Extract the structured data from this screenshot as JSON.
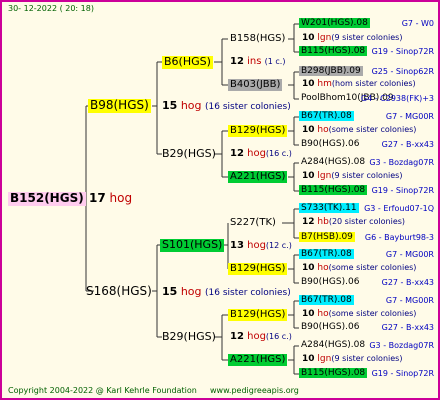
{
  "date": "30- 12-2022 ( 20: 18)",
  "copyright": "Copyright 2004-2022 @ Karl Kehrle Foundation",
  "url": "www.pedigreeapis.org",
  "colors": {
    "frame": "#cc0099",
    "hog": "#c00000",
    "link": "#0000c0"
  },
  "gen1": {
    "id": "B152(HGS)",
    "num": "17",
    "hog": "hog"
  },
  "gen2": [
    {
      "id": "B98(HGS)",
      "num": "15",
      "hog": "hog",
      "note": "(16 sister colonies)"
    },
    {
      "id": "S168(HGS)",
      "num": "15",
      "hog": "hog",
      "note": "(16 sister colonies)"
    }
  ],
  "gen3": [
    {
      "id": "B6(HGS)",
      "num": "12",
      "hog": "ins",
      "note": "(1 c.)"
    },
    {
      "id": "B29(HGS)",
      "num": "12",
      "hog": "hog",
      "note": "(16 c.)"
    },
    {
      "id": "S101(HGS)",
      "num": "13",
      "hog": "hog",
      "note": "(12 c.)"
    },
    {
      "id": "B29(HGS)",
      "num": "12",
      "hog": "hog",
      "note": "(16 c.)"
    }
  ],
  "gen4": [
    {
      "id": "B158(HGS)",
      "num": "10",
      "hog": "lgn",
      "note": "(9 sister colonies)"
    },
    {
      "id": "B403(JBB)",
      "num": "10",
      "hog": "hm",
      "note": "(hom sister colonies)"
    },
    {
      "id": "B129(HGS)",
      "num": "10",
      "hog": "ho",
      "note": "(some sister colonies)"
    },
    {
      "id": "A221(HGS)",
      "num": "10",
      "hog": "lgn",
      "note": "(9 sister colonies)"
    },
    {
      "id": "S227(TK)",
      "num": "12",
      "hog": "hb",
      "note": "(20 sister colonies)"
    },
    {
      "id": "B129(HGS)",
      "num": "10",
      "hog": "ho",
      "note": "(some sister colonies)"
    },
    {
      "id": "B129(HGS)",
      "num": "10",
      "hog": "ho",
      "note": "(some sister colonies)"
    },
    {
      "id": "A221(HGS)",
      "num": "10",
      "hog": "lgn",
      "note": "(9 sister colonies)"
    }
  ],
  "gen5": [
    {
      "id": "W201(HGS).08",
      "link": "G7 - W0"
    },
    {
      "id": "B115(HGS).08",
      "link": "G19 - Sinop72R"
    },
    {
      "id": "B298(JBB).09",
      "link": "G25 - Sinop62R"
    },
    {
      "id": "PoolBhom10(JBB).09",
      "link": "PoolBhom10(JBB).09"
    },
    {
      "id": "B67(TR).08",
      "link": "G7 - MG00R"
    },
    {
      "id": "B90(HGS).06",
      "link": "G27 - B-xx43"
    },
    {
      "id": "A284(HGS).08",
      "link": "G3 - Bozdag07R"
    },
    {
      "id": "B115(HGS).08",
      "link": "G19 - Sinop72R"
    },
    {
      "id": "S733(TK).11",
      "link": "G3 - Erfoud07-1Q"
    },
    {
      "id": "B7(HSB).09",
      "link": "G6 - Bayburt98-3"
    },
    {
      "id": "B67(TR).08",
      "link": "G7 - MG00R"
    },
    {
      "id": "B90(HGS).06",
      "link": "G27 - B-xx43"
    },
    {
      "id": "B67(TR).08",
      "link": "G7 - MG00R"
    },
    {
      "id": "B90(HGS).06",
      "link": "G27 - B-xx43"
    },
    {
      "id": "A284(HGS).08",
      "link": "G3 - Bozdag07R"
    },
    {
      "id": "B115(HGS).08",
      "link": "G19 - Sinop72R"
    }
  ],
  "pool_link": "G4 - C2938(FK)+3"
}
